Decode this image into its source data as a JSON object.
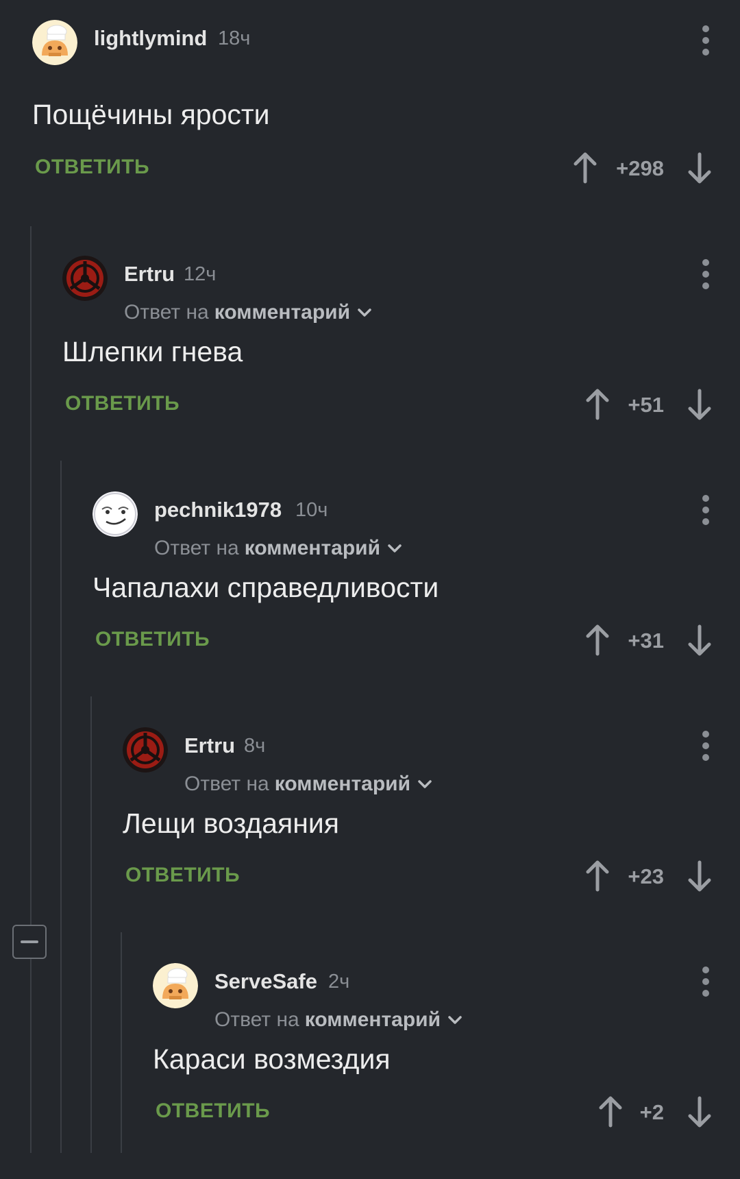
{
  "reply_prefix": "Ответ на",
  "comments": [
    {
      "username": "lightlymind",
      "time": "18ч",
      "text": "Пощёчины ярости",
      "reply_label": "ОТВЕТИТЬ",
      "score": "+298"
    },
    {
      "username": "Ertru",
      "time": "12ч",
      "reply_target": "комментарий",
      "text": "Шлепки гнева",
      "reply_label": "ОТВЕТИТЬ",
      "score": "+51"
    },
    {
      "username": "pechnik1978",
      "time": "10ч",
      "reply_target": "комментарий",
      "text": "Чапалахи справедливости",
      "reply_label": "ОТВЕТИТЬ",
      "score": "+31"
    },
    {
      "username": "Ertru",
      "time": "8ч",
      "reply_target": "комментарий",
      "text": "Лещи воздаяния",
      "reply_label": "ОТВЕТИТЬ",
      "score": "+23"
    },
    {
      "username": "ServeSafe",
      "time": "2ч",
      "reply_target": "комментарий",
      "text": "Караси возмездия",
      "reply_label": "ОТВЕТИТЬ",
      "score": "+2"
    }
  ],
  "icons": {
    "avatar_1": "chef-avatar-icon",
    "avatar_2": "emblem-avatar-icon",
    "avatar_3": "meme-face-avatar-icon",
    "avatar_4": "emblem-avatar-icon",
    "avatar_5": "chef-avatar-icon",
    "upvote": "arrow-up-icon",
    "downvote": "arrow-down-icon",
    "menu": "more-vertical-icon",
    "collapse": "minus-icon"
  },
  "colors": {
    "background": "#24272c",
    "reply_green": "#6a9a4b",
    "muted": "#8b8f95"
  }
}
